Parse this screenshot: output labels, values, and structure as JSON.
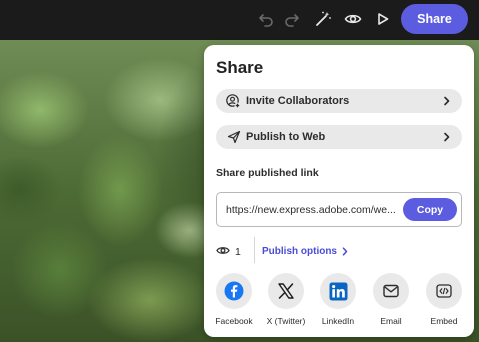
{
  "toolbar": {
    "share_label": "Share",
    "icons": [
      "undo-icon",
      "redo-icon",
      "magic-wand-icon",
      "eye-icon",
      "play-icon"
    ]
  },
  "panel": {
    "title": "Share",
    "invite_label": "Invite Collaborators",
    "publish_label": "Publish to Web",
    "section_label": "Share published link",
    "link_value": "https://new.express.adobe.com/we...",
    "copy_label": "Copy",
    "view_count": "1",
    "publish_options_label": "Publish options"
  },
  "social": [
    {
      "label": "Facebook",
      "icon": "facebook-icon"
    },
    {
      "label": "X (Twitter)",
      "icon": "x-twitter-icon"
    },
    {
      "label": "LinkedIn",
      "icon": "linkedin-icon"
    },
    {
      "label": "Email",
      "icon": "email-icon"
    },
    {
      "label": "Embed",
      "icon": "embed-icon"
    }
  ],
  "colors": {
    "accent": "#5c5ce0",
    "link": "#4b4bd6",
    "facebook": "#1877f2",
    "linkedin": "#0a66c2",
    "topbar": "#1b1b1b"
  }
}
